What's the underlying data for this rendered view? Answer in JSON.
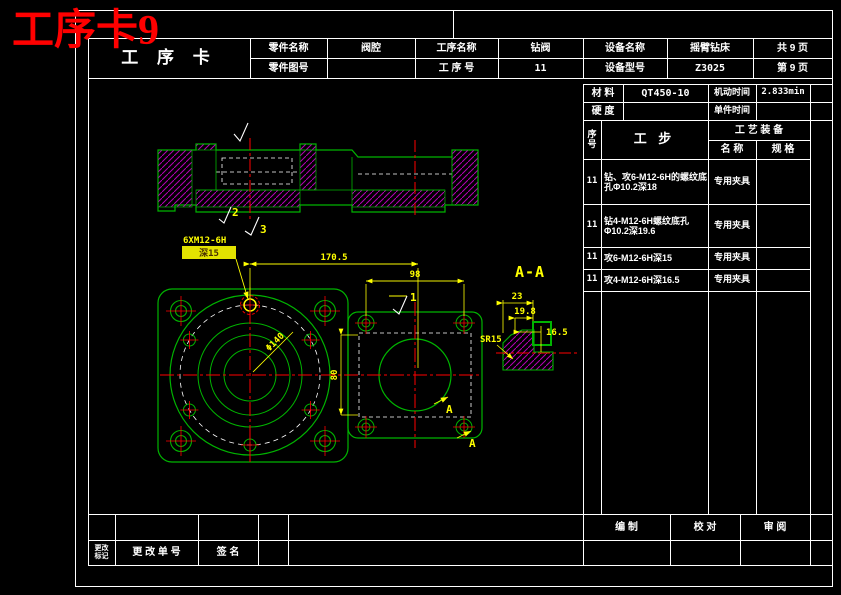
{
  "overlay": {
    "red_title": "工序卡9"
  },
  "title_block": {
    "card_title": "工  序  卡",
    "part_name_label": "零件名称",
    "part_name": "阀腔",
    "process_name_label": "工序名称",
    "process_name": "钻阀",
    "part_no_label": "零件图号",
    "part_no": "",
    "process_no_label": "工 序 号",
    "process_no": "11",
    "equip_name_label": "设备名称",
    "equip_name": "摇臂钻床",
    "equip_model_label": "设备型号",
    "equip_model": "Z3025",
    "pages_total": "共 9 页",
    "page_no": "第 9 页"
  },
  "info_block": {
    "material_label": "材  料",
    "material": "QT450-10",
    "machine_time_label": "机动时间",
    "machine_time": "2.833min",
    "hardness_label": "硬  度",
    "hardness": "",
    "unit_time_label": "单件时间",
    "unit_time": ""
  },
  "steps_table": {
    "seq_header": "序\n号",
    "step_header": "工    步",
    "tooling_header": "工 艺 装 备",
    "name_header": "名  称",
    "spec_header": "规  格",
    "rows": [
      {
        "seq": "11",
        "step": "钻、攻6-M12-6H的螺纹底孔Φ10.2深18",
        "tool": "专用夹具",
        "spec": ""
      },
      {
        "seq": "11",
        "step": "钻4-M12-6H螺纹底孔Φ10.2深19.6",
        "tool": "专用夹具",
        "spec": ""
      },
      {
        "seq": "11",
        "step": "攻6-M12-6H深15",
        "tool": "专用夹具",
        "spec": ""
      },
      {
        "seq": "11",
        "step": "攻4-M12-6H深16.5",
        "tool": "专用夹具",
        "spec": ""
      }
    ]
  },
  "approval_block": {
    "compile_label": "编  制",
    "check_label": "校  对",
    "review_label": "审  阅"
  },
  "revision_block": {
    "mark_label": "更改\n标记",
    "order_label": "更 改 单 号",
    "sign_label": "签  名"
  },
  "drawing": {
    "section_top": {
      "callout_2": "2",
      "callout_3": "3"
    },
    "plan": {
      "bolt_note": "6XM12-6H",
      "highlight": "深15",
      "dim_170_5": "170.5",
      "dim_98": "98",
      "dim_80": "80",
      "dim_phi140": "Φ140",
      "callout_1": "1",
      "section_arrow": "A"
    },
    "section_aa": {
      "label": "A-A",
      "dim_23": "23",
      "dim_19_8": "19.8",
      "dim_16_5": "16.5",
      "dim_sr15": "SR15"
    }
  },
  "colors": {
    "line_green": "#00b400",
    "hatch_magenta": "#b400b4",
    "centerline_red": "#ff0000",
    "dim_yellow": "#ffff00",
    "table_white": "#ffffff",
    "title_red": "#ff0000",
    "highlight_bg": "#e3e300"
  }
}
